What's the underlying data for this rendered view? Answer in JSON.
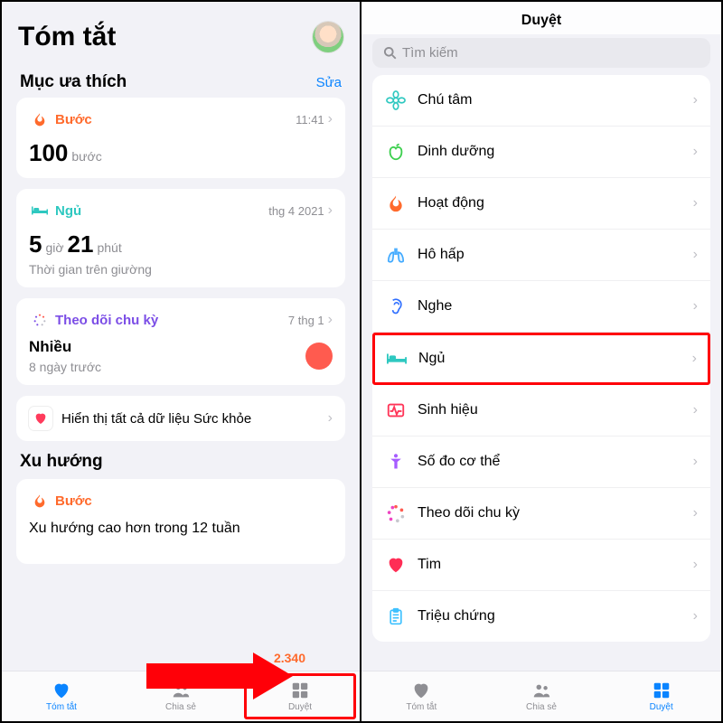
{
  "left": {
    "title": "Tóm tắt",
    "favHeader": "Mục ưa thích",
    "edit": "Sửa",
    "steps": {
      "label": "Bước",
      "time": "11:41",
      "value": "100",
      "unit": "bước"
    },
    "sleep": {
      "label": "Ngủ",
      "time": "thg 4 2021",
      "h": "5",
      "hUnit": "giờ",
      "m": "21",
      "mUnit": "phút",
      "sub": "Thời gian trên giường"
    },
    "cycle": {
      "label": "Theo dõi chu kỳ",
      "time": "7 thg 1",
      "status": "Nhiều",
      "ago": "8 ngày trước"
    },
    "showAll": "Hiển thị tất cả dữ liệu Sức khỏe",
    "trendHeader": "Xu hướng",
    "trendCard": {
      "label": "Bước",
      "text": "Xu hướng cao hơn trong 12 tuần",
      "value": "2.340"
    }
  },
  "right": {
    "title": "Duyệt",
    "searchPlaceholder": "Tìm kiếm",
    "items": [
      {
        "label": "Chú tâm"
      },
      {
        "label": "Dinh dưỡng"
      },
      {
        "label": "Hoạt động"
      },
      {
        "label": "Hô hấp"
      },
      {
        "label": "Nghe"
      },
      {
        "label": "Ngủ",
        "highlight": true
      },
      {
        "label": "Sinh hiệu"
      },
      {
        "label": "Số đo cơ thể"
      },
      {
        "label": "Theo dõi chu kỳ"
      },
      {
        "label": "Tim"
      },
      {
        "label": "Triệu chứng"
      }
    ]
  },
  "tabs": {
    "summary": "Tóm tắt",
    "share": "Chia sẻ",
    "browse": "Duyệt"
  }
}
